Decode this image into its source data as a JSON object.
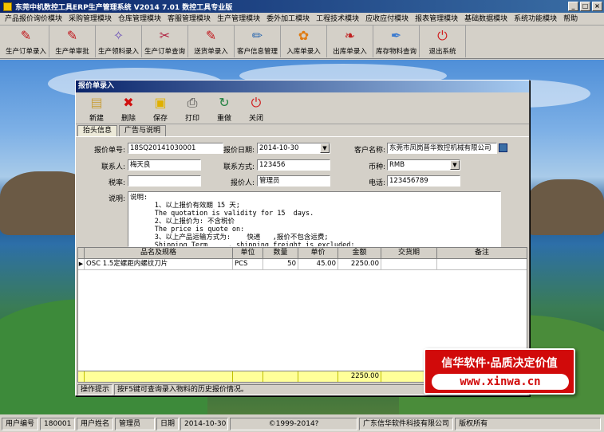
{
  "window": {
    "title": "东莞中机数控工具ERP生产管理系统  V2014 7.01 数控工具专业版",
    "buttons": [
      "_",
      "□",
      "×"
    ]
  },
  "menu": [
    "产品报价询价模块",
    "采购管理模块",
    "仓库管理模块",
    "客服管理模块",
    "生产管理模块",
    "委外加工模块",
    "工程技术模块",
    "应收应付模块",
    "报表管理模块",
    "基础数据模块",
    "系统功能模块",
    "帮助"
  ],
  "toolbar": [
    {
      "label": "生产订单录入",
      "icon": "pdf-icon",
      "glyph": "✎",
      "color": "#c0151b"
    },
    {
      "label": "生产单审批",
      "icon": "pdf-icon",
      "glyph": "✎",
      "color": "#c0151b"
    },
    {
      "label": "生产领料录入",
      "icon": "crystal-icon",
      "glyph": "✧",
      "color": "#6a4fb8"
    },
    {
      "label": "生产订单查询",
      "icon": "scissors-icon",
      "glyph": "✂",
      "color": "#b02040"
    },
    {
      "label": "送货单录入",
      "icon": "pdf-icon",
      "glyph": "✎",
      "color": "#c0151b"
    },
    {
      "label": "客户信息管理",
      "icon": "pencil-icon",
      "glyph": "✏",
      "color": "#2f6ab0"
    },
    {
      "label": "入库单录入",
      "icon": "flower-icon",
      "glyph": "✿",
      "color": "#e07a10"
    },
    {
      "label": "出库单录入",
      "icon": "leaf-icon",
      "glyph": "❧",
      "color": "#c02020"
    },
    {
      "label": "库存物料查询",
      "icon": "feather-icon",
      "glyph": "✒",
      "color": "#3a7ad0"
    },
    {
      "label": "退出系统",
      "icon": "power-icon",
      "glyph": "⏻",
      "color": "#d02020"
    }
  ],
  "dialog": {
    "title": "报价单录入",
    "toolbar": [
      {
        "label": "新建",
        "icon": "new-doc-icon",
        "glyph": "▤",
        "color": "#c8a040"
      },
      {
        "label": "删除",
        "icon": "delete-icon",
        "glyph": "✖",
        "color": "#d01010"
      },
      {
        "label": "保存",
        "icon": "save-icon",
        "glyph": "▣",
        "color": "#e0b000"
      },
      {
        "label": "打印",
        "icon": "print-icon",
        "glyph": "⎙",
        "color": "#404040"
      },
      {
        "label": "重做",
        "icon": "redo-icon",
        "glyph": "↻",
        "color": "#208040"
      },
      {
        "label": "关闭",
        "icon": "close-icon",
        "glyph": "⏻",
        "color": "#d02020"
      }
    ],
    "tabs": [
      "抬头信息",
      "广告与说明"
    ],
    "form": {
      "quote_no_label": "报价单号:",
      "quote_no": "18SQ20141030001",
      "quote_date_label": "报价日期:",
      "quote_date": "2014-10-30",
      "customer_label": "客户名称:",
      "customer": "东莞市凤岗普华数控机械有限公司",
      "contact_label": "联系人:",
      "contact": "梅天良",
      "contact_method_label": "联系方式:",
      "contact_method": "123456",
      "currency_label": "币种:",
      "currency": "RMB",
      "tax_label": "税率:",
      "tax": "",
      "quoter_label": "报价人:",
      "quoter": "管理员",
      "phone_label": "电话:",
      "phone": "123456789",
      "notes_label": "说明:",
      "notes": "说明:\n      1、以上报价有效期 15 天;\n      The quotation is validity for 15  days.\n      2、以上报价为: 不含税价\n      The price is quote on:\n      3、以上产品运输方式为:    快递   ,报价不包含运费;\n      Shipping Term     . shipping freight is excluded;"
    },
    "grid": {
      "columns": [
        "品名及规格",
        "单位",
        "数量",
        "单价",
        "金额",
        "交货期",
        "备注"
      ],
      "rows": [
        {
          "name": "OSC 1.5定螺距内螺纹刀片",
          "unit": "PCS",
          "qty": "50",
          "price": "45.00",
          "amount": "2250.00",
          "delivery": "",
          "remark": ""
        }
      ],
      "total_amount": "2250.00"
    },
    "hint_label": "操作提示",
    "hint_text": "按F5键可查询录入物料的历史报价情况。"
  },
  "promo": {
    "slogan": "信华软件·品质决定价值",
    "url": "www.xinwa.cn"
  },
  "status": {
    "user_no_label": "用户编号",
    "user_no": "180001",
    "user_name_label": "用户姓名",
    "user_name": "管理员",
    "date_label": "日期",
    "date": "2014-10-30",
    "copyright": "©1999-2014?",
    "company": "广东信华软件科技有限公司",
    "rights": "版权所有"
  }
}
